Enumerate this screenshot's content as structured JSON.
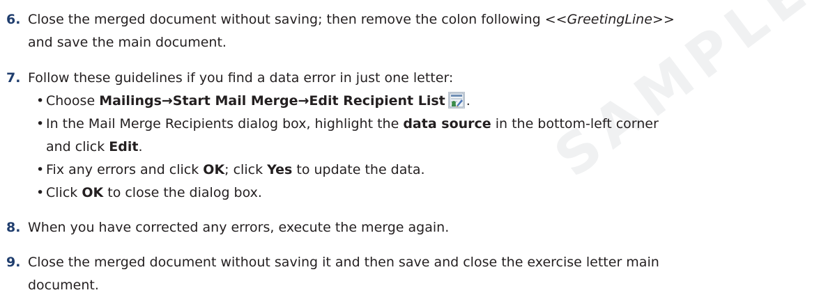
{
  "watermark": {
    "text": "SAMPLE"
  },
  "steps": [
    {
      "number": "6.",
      "line1_a": "Close the merged document without saving; then remove the colon following ",
      "line1_field": "<<GreetingLine>>",
      "line2": "and save the main document."
    },
    {
      "number": "7.",
      "intro": "Follow these guidelines if you find a data error in just one letter:",
      "bullets": [
        {
          "prefix": "Choose ",
          "bold_path": "Mailings→Start Mail Merge→Edit Recipient List",
          "icon": "edit-recipient-list-icon",
          "suffix": "."
        },
        {
          "prefix": "In the Mail Merge Recipients dialog box, highlight the ",
          "bold": "data source",
          "middle": " in the bottom-left corner",
          "line2_prefix": "and click ",
          "line2_bold": "Edit",
          "line2_suffix": "."
        },
        {
          "prefix": "Fix any errors and click ",
          "bold": "OK",
          "middle": "; click ",
          "bold2": "Yes",
          "suffix": " to update the data."
        },
        {
          "prefix": "Click ",
          "bold": "OK",
          "suffix": " to close the dialog box."
        }
      ]
    },
    {
      "number": "8.",
      "text": "When you have corrected any errors, execute the merge again."
    },
    {
      "number": "9.",
      "line1": "Close the merged document without saving it and then save and close the exercise letter main",
      "line2": "document."
    }
  ]
}
